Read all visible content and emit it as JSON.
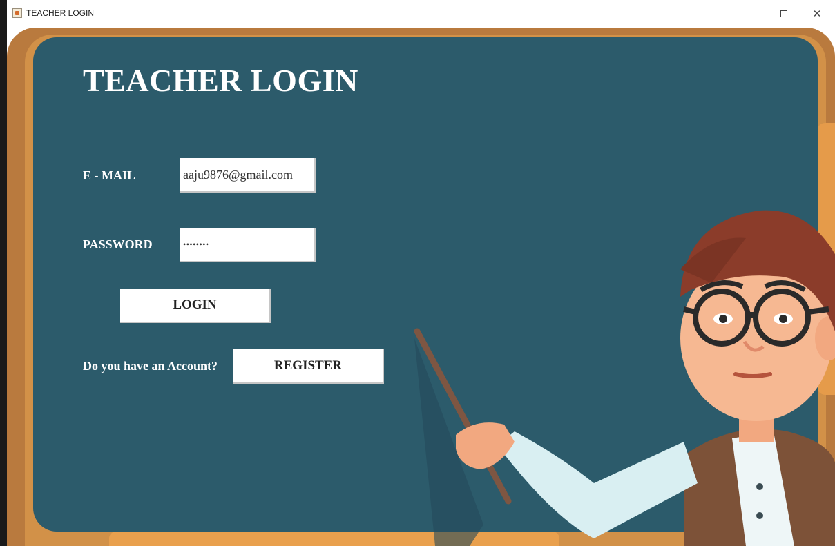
{
  "window": {
    "title": "TEACHER LOGIN",
    "minimize_glyph": "–",
    "maximize_glyph": "□",
    "close_glyph": "✕"
  },
  "form": {
    "heading": "TEACHER LOGIN",
    "email_label": "E - MAIL",
    "email_value": "aaju9876@gmail.com",
    "password_label": "PASSWORD",
    "password_value": "••••••••",
    "login_label": "LOGIN",
    "account_prompt": "Do you have an Account?",
    "register_label": "REGISTER"
  },
  "colors": {
    "board": "#2c5b6b",
    "frame": "#b97a3e",
    "frame_light": "#d29148",
    "accent": "#e59b4a",
    "button_bg": "#ffffff"
  },
  "icons": {
    "app": "java-cup-icon",
    "minimize": "minimize-icon",
    "maximize": "maximize-icon",
    "close": "close-icon"
  }
}
